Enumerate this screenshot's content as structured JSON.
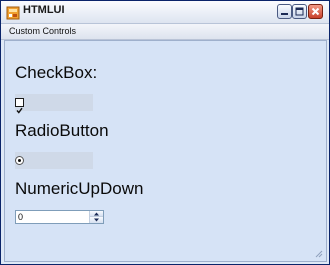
{
  "window": {
    "title": "HTMLUI",
    "icon": "app-icon",
    "controls": [
      "minimize-icon",
      "maximize-icon",
      "close-icon"
    ]
  },
  "menubar": {
    "items": [
      {
        "label": "Custom Controls"
      }
    ]
  },
  "sections": {
    "checkbox": {
      "heading": "CheckBox:",
      "checked": true,
      "label": ""
    },
    "radio": {
      "heading": "RadioButton",
      "selected": true,
      "label": ""
    },
    "numeric": {
      "heading": "NumericUpDown",
      "value": "0"
    }
  },
  "colors": {
    "client_background": "#d6e3f6",
    "close_button": "#c7402a"
  }
}
